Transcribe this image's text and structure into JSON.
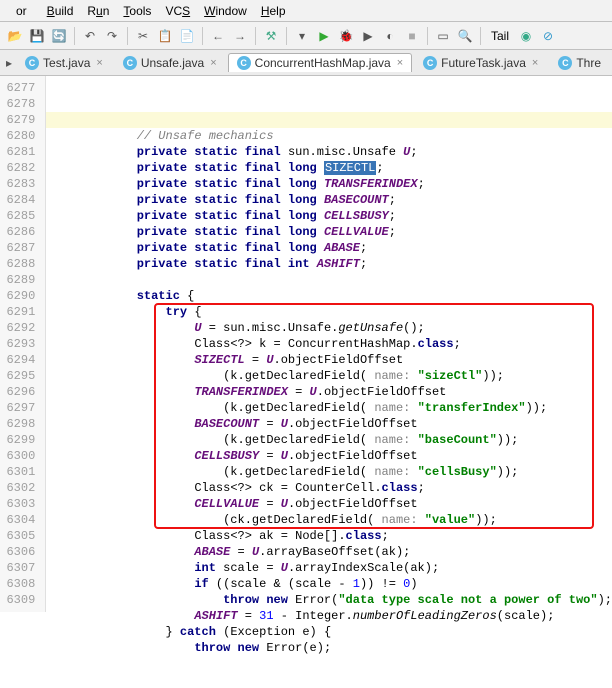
{
  "menu": {
    "items": [
      "or",
      "Build",
      "Run",
      "Tools",
      "VCS",
      "Window",
      "Help"
    ]
  },
  "toolbar": {
    "tail": "Tail"
  },
  "tabs": [
    {
      "label": "Test.java"
    },
    {
      "label": "Unsafe.java"
    },
    {
      "label": "ConcurrentHashMap.java",
      "active": true
    },
    {
      "label": "FutureTask.java"
    },
    {
      "label": "Thre"
    }
  ],
  "gutter_start": 6277,
  "gutter_end": 6309,
  "code": {
    "c": "// Unsafe mechanics",
    "l1a": "private static final ",
    "l1b": "sun.misc.Unsafe ",
    "l1c": "U",
    "l1d": ";",
    "l2a": "private static final long ",
    "l2b": "SIZECTL",
    "l2c": ";",
    "l3a": "private static final long ",
    "l3b": "TRANSFERINDEX",
    "l3c": ";",
    "l4a": "private static final long ",
    "l4b": "BASECOUNT",
    "l4c": ";",
    "l5a": "private static final long ",
    "l5b": "CELLSBUSY",
    "l5c": ";",
    "l6a": "private static final long ",
    "l6b": "CELLVALUE",
    "l6c": ";",
    "l7a": "private static final long ",
    "l7b": "ABASE",
    "l7c": ";",
    "l8a": "private static final int ",
    "l8b": "ASHIFT",
    "l8c": ";",
    "st": "static ",
    "ob": "{",
    "tr": "try ",
    "u1a": "U ",
    "u1b": "= sun.misc.Unsafe.",
    "u1c": "getUnsafe",
    "u1d": "();",
    "k1": "Class<?> k = ConcurrentHashMap.",
    "k1b": "class",
    "k1c": ";",
    "s1a": "SIZECTL ",
    "s1b": "= ",
    "s1c": "U",
    "s1d": ".objectFieldOffset",
    "s1e": "(k.getDeclaredField( ",
    "s1p": "name: ",
    "s1v": "\"sizeCtl\"",
    "s1f": "));",
    "t1a": "TRANSFERINDEX ",
    "t1d": ".objectFieldOffset",
    "t1v": "\"transferIndex\"",
    "b1a": "BASECOUNT ",
    "b1v": "\"baseCount\"",
    "c1a": "CELLSBUSY ",
    "c1v": "\"cellsBusy\"",
    "ck": "Class<?> ck = CounterCell.",
    "cls": "class",
    "cv1a": "CELLVALUE ",
    "cv1e": "(ck.getDeclaredField( ",
    "cv1v": "\"value\"",
    "ak": "Class<?> ak = Node[].",
    "ab1a": "ABASE ",
    "ab1b": "= ",
    "ab1d": ".arrayBaseOffset(ak);",
    "sc1": "int ",
    "sc2": "scale = ",
    "sc3": "U",
    "sc4": ".arrayIndexScale(ak);",
    "if1": "if ",
    "if2": "((scale & (scale - ",
    "if3": "1",
    "if4": ")) != ",
    "if5": "0",
    "if6": ")",
    "th1": "throw new ",
    "th2": "Error(",
    "th3": "\"data type scale not a power of two\"",
    "th4": ");",
    "as1": "ASHIFT ",
    "as2": "= ",
    "as3": "31",
    "as4": " - Integer.",
    "as5": "numberOfLeadingZeros",
    "as6": "(scale);",
    "ca1": "} ",
    "ca2": "catch ",
    "ca3": "(Exception e) {",
    "tn1": "throw new ",
    "tn2": "Error(e);"
  }
}
